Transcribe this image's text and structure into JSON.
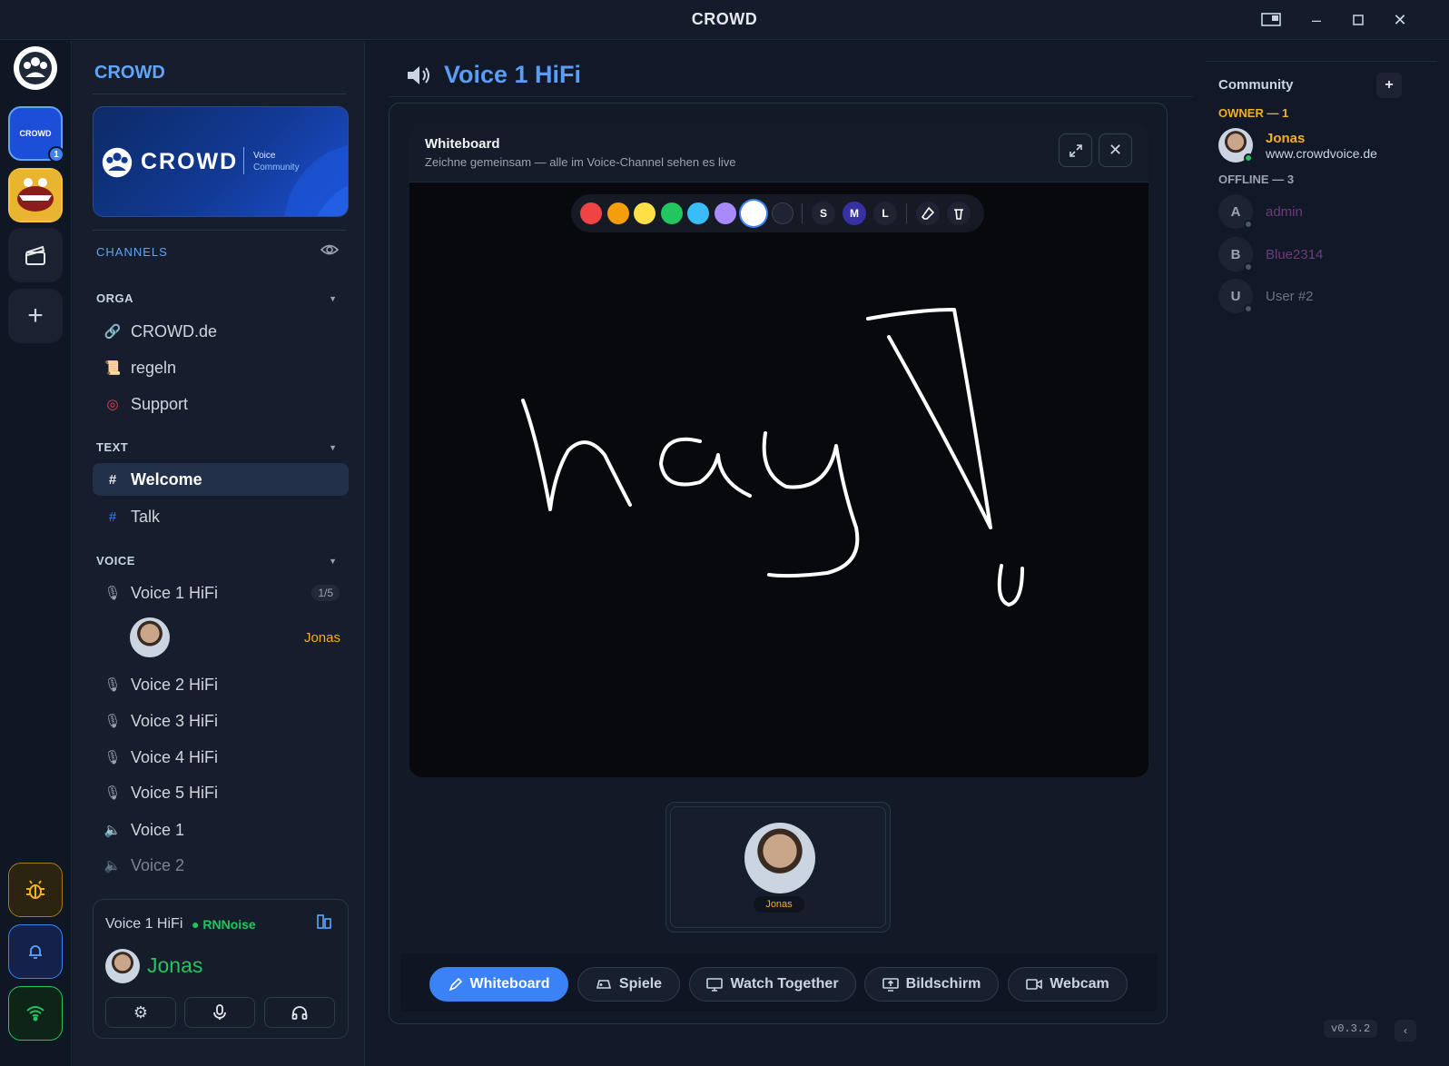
{
  "window": {
    "title": "CROWD",
    "controls": [
      "snap",
      "minimize",
      "maximize",
      "close"
    ]
  },
  "rail": {
    "servers": [
      {
        "name": "CROWD",
        "badge": "1",
        "active": true
      },
      {
        "name": "meme-server"
      },
      {
        "name": "cinema"
      }
    ],
    "add_label": "+",
    "bottom": [
      "bug-report",
      "notifications",
      "connection"
    ]
  },
  "sidebar": {
    "server_name": "CROWD",
    "banner": {
      "logo_text": "CROWD",
      "tag_line1": "Voice",
      "tag_line2": "Community"
    },
    "channels_label": "CHANNELS",
    "sections": {
      "orga": {
        "label": "ORGA",
        "items": [
          {
            "label": "CROWD.de",
            "icon": "link-icon"
          },
          {
            "label": "regeln",
            "icon": "scroll-icon"
          },
          {
            "label": "Support",
            "icon": "lifebuoy-icon"
          }
        ]
      },
      "text": {
        "label": "TEXT",
        "items": [
          {
            "label": "Welcome",
            "icon": "#",
            "active": true
          },
          {
            "label": "Talk",
            "icon": "#"
          }
        ]
      },
      "voice": {
        "label": "VOICE",
        "items": [
          {
            "label": "Voice 1 HiFi",
            "icon": "mic-icon",
            "count": "1/5"
          },
          {
            "label": "Voice 2 HiFi",
            "icon": "mic-icon"
          },
          {
            "label": "Voice 3 HiFi",
            "icon": "mic-icon"
          },
          {
            "label": "Voice 4 HiFi",
            "icon": "mic-icon"
          },
          {
            "label": "Voice 5 HiFi",
            "icon": "mic-icon"
          },
          {
            "label": "Voice 1",
            "icon": "speaker-icon"
          },
          {
            "label": "Voice 2",
            "icon": "speaker-icon"
          }
        ],
        "connected_user": "Jonas"
      }
    },
    "voice_panel": {
      "channel": "Voice 1 HiFi",
      "noise": "RNNoise",
      "user": "Jonas"
    }
  },
  "main": {
    "channel_title": "Voice 1 HiFi",
    "whiteboard": {
      "title": "Whiteboard",
      "subtitle": "Zeichne gemeinsam — alle im Voice-Channel sehen es live",
      "colors": [
        "#ef4444",
        "#f59e0b",
        "#fde047",
        "#22c55e",
        "#38bdf8",
        "#a78bfa",
        "#ffffff",
        "#1e2433"
      ],
      "selected_color": "#ffffff",
      "sizes": [
        "S",
        "M",
        "L"
      ],
      "selected_size": "M",
      "drawing_text": "hay!"
    },
    "participant": {
      "name": "Jonas"
    },
    "toolbar": [
      {
        "label": "Whiteboard",
        "icon": "pen-icon",
        "active": true
      },
      {
        "label": "Spiele",
        "icon": "gamepad-icon"
      },
      {
        "label": "Watch Together",
        "icon": "monitor-icon"
      },
      {
        "label": "Bildschirm",
        "icon": "screen-share-icon"
      },
      {
        "label": "Webcam",
        "icon": "camera-icon"
      }
    ]
  },
  "members": {
    "title": "Community",
    "add_label": "+",
    "owner_header": "OWNER — 1",
    "owner": {
      "name": "Jonas",
      "sub": "www.crowdvoice.de"
    },
    "offline_header": "OFFLINE — 3",
    "offline": [
      {
        "initial": "A",
        "name": "admin",
        "color": "#6b3d78"
      },
      {
        "initial": "B",
        "name": "Blue2314",
        "color": "#6b3d78"
      },
      {
        "initial": "U",
        "name": "User #2",
        "color": "#6b7280"
      }
    ],
    "version": "v0.3.2"
  },
  "colors": {
    "accent": "#3b82f6",
    "owner": "#f5b01f",
    "online": "#22c55e"
  }
}
